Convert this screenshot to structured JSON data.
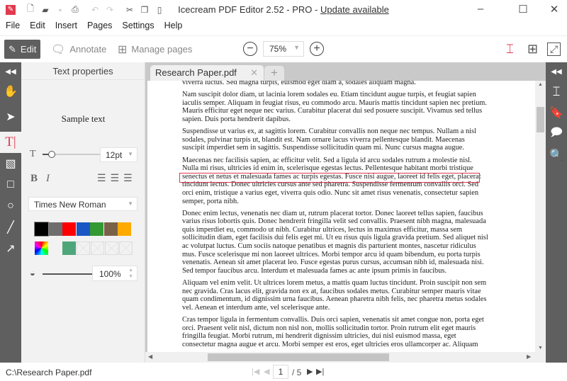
{
  "app": {
    "title": "Icecream PDF Editor 2.52 - PRO - ",
    "update_link": "Update available",
    "accent": "#e03a4f"
  },
  "menu": [
    "File",
    "Edit",
    "Insert",
    "Pages",
    "Settings",
    "Help"
  ],
  "toolbar": {
    "edit": "Edit",
    "annotate": "Annotate",
    "manage_pages": "Manage pages",
    "zoom": "75%"
  },
  "panel": {
    "title": "Text properties",
    "sample": "Sample text",
    "font_size": "12pt",
    "font": "Times New Roman",
    "opacity": "100%",
    "colors": [
      "#000000",
      "#6e6e6e",
      "#ff0000",
      "#1a56c4",
      "#339933",
      "#7a6248",
      "#ffaa00"
    ],
    "custom_color": "#4fa67a"
  },
  "tab": {
    "name": "Research Paper.pdf"
  },
  "document": {
    "paragraphs": [
      [
        "viverra luctus. Sed magna turpis, euismod eget diam a, sodales aliquam magna."
      ],
      [
        "Nam suscipit dolor diam, ut lacinia lorem sodales eu. Etiam tincidunt augue turpis, et feugiat sapien",
        "iaculis semper. Aliquam in feugiat risus, eu commodo arcu. Mauris mattis tincidunt sapien nec pretium.",
        "Mauris efficitur eget neque nec varius. Curabitur placerat dui sed posuere suscipit. Vivamus sed tellus",
        "sapien. Duis porta hendrerit dapibus."
      ],
      [
        "Suspendisse ut varius ex, at sagittis lorem. Curabitur convallis non neque nec tempus. Nullam a nisl",
        "sodales, pulvinar turpis ut, blandit est. Nam ornare lacus viverra pellentesque blandit. Maecenas",
        "suscipit imperdiet sem in sagittis. Suspendisse sollicitudin quam mi. Nunc cursus magna augue."
      ],
      [
        "Maecenas nec facilisis sapien, ac efficitur velit. Sed a ligula id arcu sodales rutrum a molestie nisl.",
        "Nulla mi risus, ultricies id enim in, scelerisque egestas lectus. Pellentesque habitant morbi tristique",
        "senectus et netus et malesuada fames ac turpis egestas. Fusce nisi augue, laoreet id felis eget, placerat",
        "tincidunt lectus. Donec ultricies cursus ante sed pharetra. Suspendisse fermentum convallis orci. Sed",
        "orci enim, tristique a varius eget, viverra quis odio. Nunc sit amet risus venenatis, consectetur sapien",
        "semper, porta nibh."
      ],
      [
        "Donec enim lectus, venenatis nec diam ut, rutrum placerat tortor. Donec laoreet tellus sapien, faucibus",
        "varius risus lobortis quis. Donec hendrerit fringilla velit sed convallis. Praesent nibh magna, malesuada",
        "quis imperdiet eu, commodo ut nibh. Curabitur ultrices, lectus in maximus efficitur, massa sem",
        "sollicitudin diam, eget facilisis dui felis eget mi. Ut eu risus quis ligula gravida pretium. Sed aliquet nisl",
        "ac volutpat luctus. Cum sociis natoque penatibus et magnis dis parturient montes, nascetur ridiculus",
        "mus. Fusce scelerisque mi non laoreet ultrices. Morbi tempor arcu id quam bibendum, eu porta turpis",
        "venenatis. Aenean sit amet placerat leo. Fusce egestas purus cursus, accumsan nibh id, malesuada nisi.",
        "Sed tempor faucibus arcu. Interdum et malesuada fames ac ante ipsum primis in faucibus."
      ],
      [
        "Aliquam vel enim velit. Ut ultrices lorem metus, a mattis quam luctus tincidunt. Proin suscipit non sem",
        "nec gravida. Cras lacus elit, gravida non ex at, faucibus sodales metus. Curabitur semper mauris vitae",
        "quam condimentum, id dignissim urna faucibus. Aenean pharetra nibh felis, nec pharetra metus sodales",
        "vel. Aenean et interdum ante, vel scelerisque ante."
      ],
      [
        "Cras tempor ligula in fermentum convallis. Duis orci sapien, venenatis sit amet congue non, porta eget",
        "orci. Praesent velit nisl, dictum non nisl non, mollis sollicitudin tortor. Proin rutrum elit eget mauris",
        "fringilla feugiat. Morbi rutrum, mi hendrerit dignissim ultricies, dui nisl euismod massa, eget",
        "consectetur magna augue et arcu. Morbi semper est eros, eget ultricies eros ullamcorper ac. Aliquam"
      ]
    ]
  },
  "status": {
    "path": "C:\\Research Paper.pdf",
    "page": "1",
    "total": "/ 5"
  }
}
